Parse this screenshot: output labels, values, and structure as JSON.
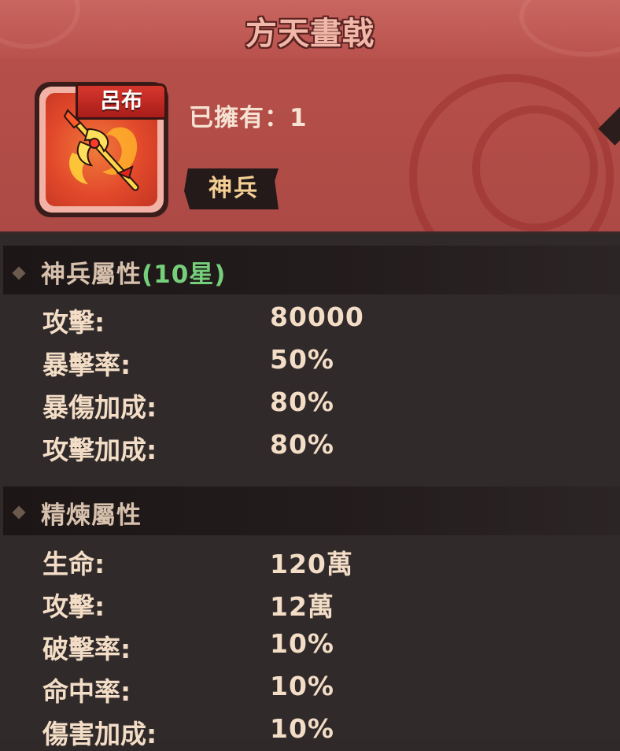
{
  "title": "方天畫戟",
  "item": {
    "owner_tag": "呂布",
    "owned_label": "已擁有：",
    "owned_count": "1",
    "rarity": "神兵"
  },
  "sections": [
    {
      "title": "神兵屬性",
      "title_suffix": "(10星)",
      "stats": [
        {
          "label": "攻擊:",
          "value": "80000"
        },
        {
          "label": "暴擊率:",
          "value": "50%"
        },
        {
          "label": "暴傷加成:",
          "value": "80%"
        },
        {
          "label": "攻擊加成:",
          "value": "80%"
        }
      ]
    },
    {
      "title": "精煉屬性",
      "title_suffix": "",
      "stats": [
        {
          "label": "生命:",
          "value": "120萬"
        },
        {
          "label": "攻擊:",
          "value": "12萬"
        },
        {
          "label": "破擊率:",
          "value": "10%"
        },
        {
          "label": "命中率:",
          "value": "10%"
        },
        {
          "label": "傷害加成:",
          "value": "10%"
        }
      ]
    }
  ],
  "colors": {
    "title_bar": "#c05a55",
    "header_panel": "#b54f49",
    "body_panel": "#302a2a",
    "stat_text": "#f3ddc6",
    "star_green": "#76d07b",
    "rarity_gold": "#f4cf93"
  },
  "icons": {
    "item": "halberd-icon",
    "section_marker": "diamond-icon"
  }
}
